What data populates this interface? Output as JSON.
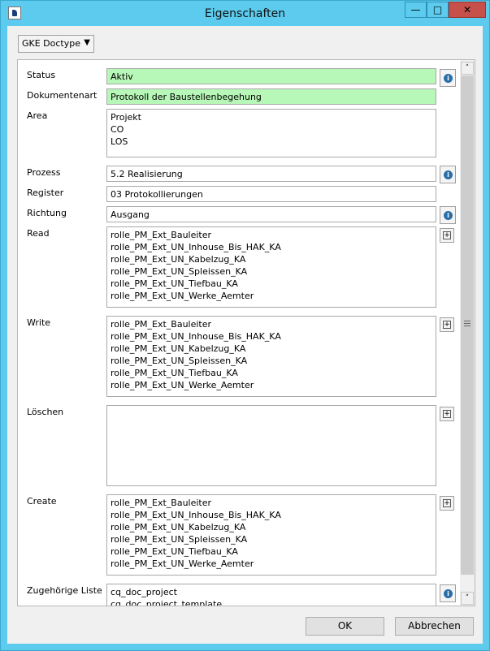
{
  "window": {
    "title": "Eigenschaften",
    "controls": {
      "minimize": "—",
      "maximize": "□",
      "close": "✕"
    }
  },
  "doctype_select": {
    "value": "GKE Doctype"
  },
  "fields": {
    "status": {
      "label": "Status",
      "value": "Aktiv"
    },
    "dokumentenart": {
      "label": "Dokumentenart",
      "value": "Protokoll der Baustellenbegehung"
    },
    "area": {
      "label": "Area",
      "values": [
        "Projekt",
        "CO",
        "LOS"
      ]
    },
    "prozess": {
      "label": "Prozess",
      "value": "5.2 Realisierung"
    },
    "register": {
      "label": "Register",
      "value": "03 Protokollierungen"
    },
    "richtung": {
      "label": "Richtung",
      "value": "Ausgang"
    },
    "read": {
      "label": "Read",
      "values": [
        "rolle_PM_Ext_Bauleiter",
        "rolle_PM_Ext_UN_Inhouse_Bis_HAK_KA",
        "rolle_PM_Ext_UN_Kabelzug_KA",
        "rolle_PM_Ext_UN_Spleissen_KA",
        "rolle_PM_Ext_UN_Tiefbau_KA",
        "rolle_PM_Ext_UN_Werke_Aemter"
      ]
    },
    "write": {
      "label": "Write",
      "values": [
        "rolle_PM_Ext_Bauleiter",
        "rolle_PM_Ext_UN_Inhouse_Bis_HAK_KA",
        "rolle_PM_Ext_UN_Kabelzug_KA",
        "rolle_PM_Ext_UN_Spleissen_KA",
        "rolle_PM_Ext_UN_Tiefbau_KA",
        "rolle_PM_Ext_UN_Werke_Aemter"
      ]
    },
    "loeschen": {
      "label": "Löschen",
      "values": []
    },
    "create": {
      "label": "Create",
      "values": [
        "rolle_PM_Ext_Bauleiter",
        "rolle_PM_Ext_UN_Inhouse_Bis_HAK_KA",
        "rolle_PM_Ext_UN_Kabelzug_KA",
        "rolle_PM_Ext_UN_Spleissen_KA",
        "rolle_PM_Ext_UN_Tiefbau_KA",
        "rolle_PM_Ext_UN_Werke_Aemter"
      ]
    },
    "zugehoerige_liste": {
      "label": "Zugehörige Liste",
      "values": [
        "cq_doc_project",
        "cq_doc_project_template"
      ]
    }
  },
  "icons": {
    "info": "info-icon",
    "plus": "plus-box-icon"
  },
  "colors": {
    "titlebar": "#5ccbee",
    "highlight_field": "#b7f7b7",
    "close_button": "#c7504b"
  },
  "buttons": {
    "ok": "OK",
    "cancel": "Abbrechen"
  }
}
